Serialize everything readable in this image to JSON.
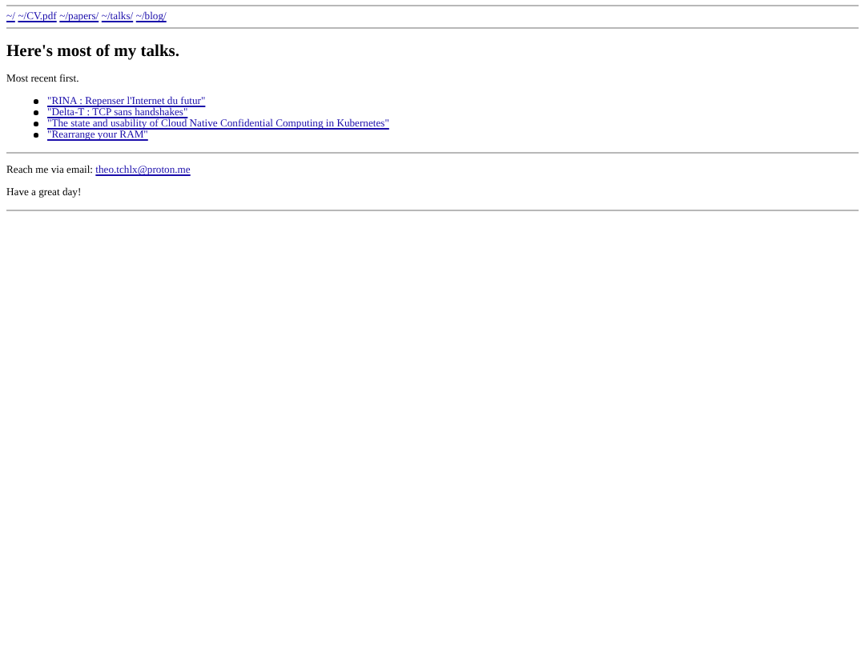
{
  "nav": [
    {
      "label": "~/"
    },
    {
      "label": "~/CV.pdf"
    },
    {
      "label": "~/papers/"
    },
    {
      "label": "~/talks/"
    },
    {
      "label": "~/blog/"
    }
  ],
  "heading": "Here's most of my talks.",
  "intro": "Most recent first.",
  "talks": [
    {
      "label": "\"RINA : Repenser l'Internet du futur\""
    },
    {
      "label": "\"Delta-T : TCP sans handshakes\""
    },
    {
      "label": "\"The state and usability of Cloud Native Confidential Computing in Kubernetes\""
    },
    {
      "label": "\"Rearrange your RAM\""
    }
  ],
  "contact": {
    "text": "Reach me via email:",
    "email": "theo.tchlx@proton.me"
  },
  "closing": "Have a great day!"
}
